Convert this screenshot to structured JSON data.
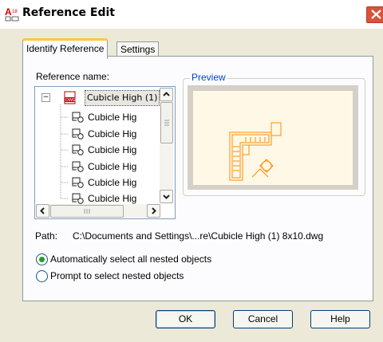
{
  "window": {
    "title": "Reference Edit",
    "app_icon": "autocad-icon",
    "close_icon": "close-icon"
  },
  "tabs": [
    {
      "label": "Identify Reference",
      "active": true
    },
    {
      "label": "Settings",
      "active": false
    }
  ],
  "reference": {
    "label": "Reference name:",
    "root": "Cubicle High (1)",
    "children": [
      "Cubicle Hig",
      "Cubicle Hig",
      "Cubicle Hig",
      "Cubicle Hig",
      "Cubicle Hig",
      "Cubicle Hig"
    ]
  },
  "preview": {
    "legend": "Preview"
  },
  "path": {
    "label": "Path:",
    "value": "C:\\Documents and Settings\\...re\\Cubicle High (1) 8x10.dwg"
  },
  "options": [
    {
      "label": "Automatically select all nested objects",
      "selected": true
    },
    {
      "label": "Prompt to select nested objects",
      "selected": false
    }
  ],
  "buttons": {
    "ok": "OK",
    "cancel": "Cancel",
    "help": "Help"
  },
  "colors": {
    "accent": "#0046d5",
    "close": "#d9533b",
    "preview_lines": "#ff8c00"
  }
}
